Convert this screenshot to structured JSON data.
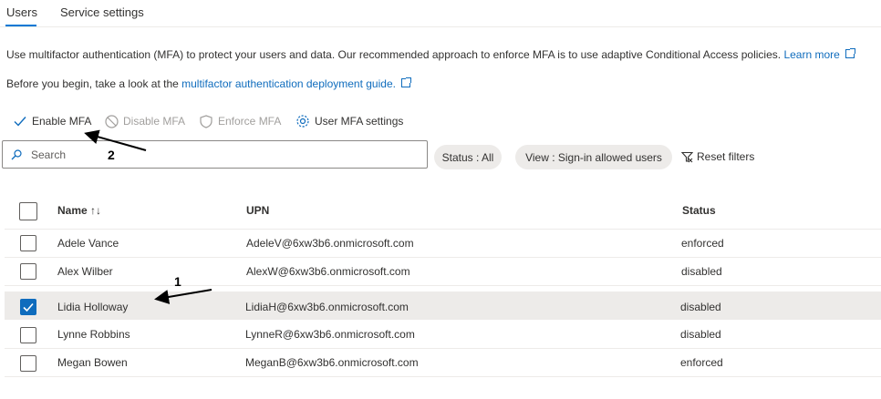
{
  "tabs": [
    {
      "label": "Users",
      "active": true
    },
    {
      "label": "Service settings",
      "active": false
    }
  ],
  "intro": {
    "text": "Use multifactor authentication (MFA) to protect your users and data. Our recommended approach to enforce MFA is to use adaptive Conditional Access policies.",
    "learn_more": "Learn more"
  },
  "guide": {
    "prefix": "Before you begin, take a look at the",
    "link": "multifactor authentication deployment guide."
  },
  "toolbar": {
    "enable": "Enable MFA",
    "disable": "Disable MFA",
    "enforce": "Enforce MFA",
    "settings": "User MFA settings"
  },
  "search": {
    "placeholder": "Search"
  },
  "filters": {
    "status": "Status : All",
    "view": "View : Sign-in allowed users",
    "reset": "Reset filters"
  },
  "table": {
    "columns": {
      "name": "Name ↑↓",
      "upn": "UPN",
      "status": "Status"
    },
    "rows": [
      {
        "name": "Adele Vance",
        "upn": "AdeleV@6xw3b6.onmicrosoft.com",
        "status": "enforced",
        "selected": false
      },
      {
        "name": "Alex Wilber",
        "upn": "AlexW@6xw3b6.onmicrosoft.com",
        "status": "disabled",
        "selected": false
      },
      {
        "name": "Lidia Holloway",
        "upn": "LidiaH@6xw3b6.onmicrosoft.com",
        "status": "disabled",
        "selected": true
      },
      {
        "name": "Lynne Robbins",
        "upn": "LynneR@6xw3b6.onmicrosoft.com",
        "status": "disabled",
        "selected": false
      },
      {
        "name": "Megan Bowen",
        "upn": "MeganB@6xw3b6.onmicrosoft.com",
        "status": "enforced",
        "selected": false
      }
    ]
  },
  "annotations": {
    "one": "1",
    "two": "2"
  },
  "colors": {
    "accent": "#0f6cbd",
    "selected_row": "#edebe9"
  }
}
